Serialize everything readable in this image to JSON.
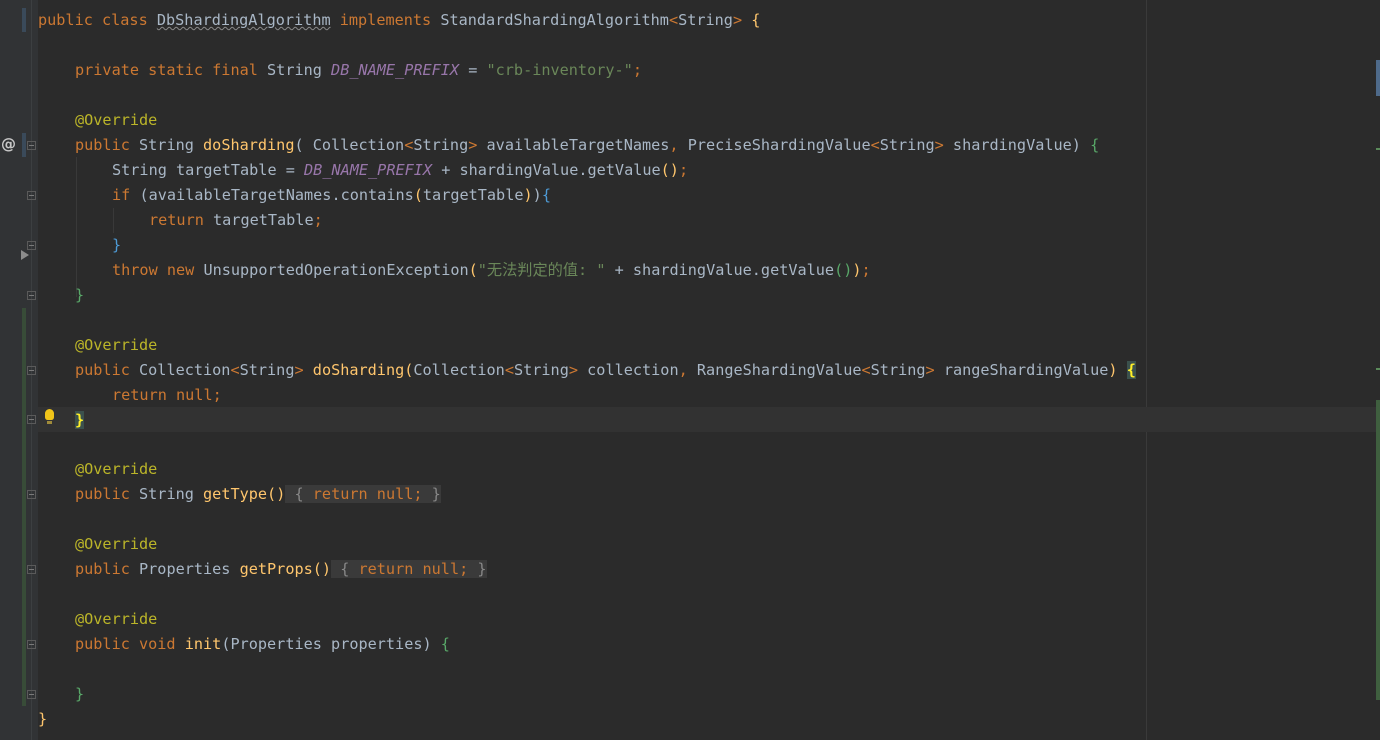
{
  "editor": {
    "language": "java",
    "class_name": "DbShardingAlgorithm",
    "gutter_icons": {
      "override_marker": "@",
      "run_marker": "run-arrow-icon",
      "intention": "lightbulb-icon"
    },
    "lines": {
      "l1": {
        "kw1": "public class ",
        "name": "DbShardingAlgorithm",
        "kw2": " implements ",
        "type": "StandardShardingAlgorithm",
        "gen_open": "<",
        "gen": "String",
        "gen_close": ">",
        "end": " {"
      },
      "l3": {
        "kw": "private static final ",
        "type": "String ",
        "const": "DB_NAME_PREFIX",
        "eq": " = ",
        "str": "\"crb-inventory-\"",
        "semi": ";"
      },
      "l5": {
        "ann": "@Override"
      },
      "l6": {
        "kw": "public ",
        "type": "String ",
        "fn": "doSharding",
        "p1": "( Collection",
        "g1o": "<",
        "g1": "String",
        "g1c": ">",
        "p2": " availableTargetNames",
        "comma": ", ",
        "p3": "PreciseShardingValue",
        "g2o": "<",
        "g2": "String",
        "g2c": ">",
        "p4": " shardingValue",
        "close": ") ",
        "brace": "{"
      },
      "l7": {
        "a": "String targetTable = ",
        "const": "DB_NAME_PREFIX",
        "b": " + shardingValue.getValue",
        "paren": "()",
        "semi": ";"
      },
      "l8": {
        "kw": "if ",
        "a": "(availableTargetNames.contains",
        "paren_o": "(",
        "b": "targetTable",
        "paren_c": ")",
        "c": ")",
        "brace": "{"
      },
      "l9": {
        "kw": "return ",
        "a": "targetTable",
        "semi": ";"
      },
      "l10": {
        "brace": "}"
      },
      "l11": {
        "kw1": "throw ",
        "kw2": "new ",
        "a": "UnsupportedOperationException",
        "po": "(",
        "str": "\"无法判定的值: \"",
        "b": " + shardingValue.getValue",
        "paren": "()",
        "pc": ")",
        "semi": ";"
      },
      "l12": {
        "brace": "}"
      },
      "l14": {
        "ann": "@Override"
      },
      "l15": {
        "kw": "public ",
        "a": "Collection",
        "go": "<",
        "g": "String",
        "gc": ">",
        "sp": " ",
        "fn": "doSharding",
        "po": "(",
        "b": "Collection",
        "g2o": "<",
        "g2": "String",
        "g2c": ">",
        "c": " collection",
        "comma": ", ",
        "d": "RangeShardingValue",
        "g3o": "<",
        "g3": "String",
        "g3c": ">",
        "e": " rangeShardingValue",
        "pc": ") ",
        "brace": "{"
      },
      "l16": {
        "kw": "return ",
        "kw2": "null",
        "semi": ";"
      },
      "l17": {
        "brace": "}"
      },
      "l19": {
        "ann": "@Override"
      },
      "l20": {
        "kw": "public ",
        "type": "String ",
        "fn": "getType",
        "paren": "()",
        "body_o": " { ",
        "kw2": "return ",
        "kw3": "null",
        "semi": ";",
        "body_c": " }"
      },
      "l22": {
        "ann": "@Override"
      },
      "l23": {
        "kw": "public ",
        "type": "Properties ",
        "fn": "getProps",
        "paren": "()",
        "body_o": " { ",
        "kw2": "return ",
        "kw3": "null",
        "semi": ";",
        "body_c": " }"
      },
      "l25": {
        "ann": "@Override"
      },
      "l26": {
        "kw": "public void ",
        "fn": "init",
        "po": "(",
        "a": "Properties properties",
        "pc": ") ",
        "brace": "{"
      },
      "l28": {
        "brace": "}"
      },
      "l29": {
        "brace": "}"
      }
    }
  }
}
